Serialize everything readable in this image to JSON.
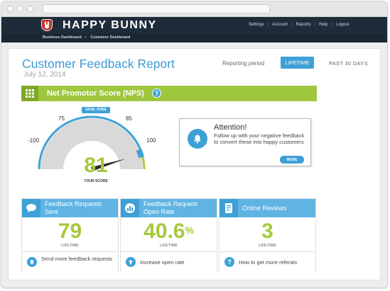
{
  "app": {
    "brand": "HAPPY BUNNY"
  },
  "topnav": [
    "Settings",
    "Account",
    "Reports",
    "Help",
    "Logout"
  ],
  "breadcrumbs": [
    "Business Dashboard",
    "Customer Dashboard"
  ],
  "report": {
    "title": "Customer Feedback Report",
    "date": "July 12, 2014",
    "period_label": "Reporting period",
    "period_selected": "LIFETIME",
    "period_other": "PAST 30 DAYS"
  },
  "nps": {
    "title": "Net Promotor Score (NPS)",
    "help": "?",
    "goal_zone": "GOAL ZONE",
    "min_label": "-100",
    "max_label": "100",
    "goal_low": "75",
    "goal_high": "85",
    "score": "81",
    "score_label": "YOUR SCORE",
    "gauge_value": 81
  },
  "attention": {
    "title": "Attention!",
    "text": "Follow up with your negative feedback to convert these into happy customers",
    "more": "MORE"
  },
  "cards": [
    {
      "title": "Feedback Requests Sent",
      "value": "79",
      "suffix": "",
      "sub": "LIFETIME",
      "action": "Send more feedback requests"
    },
    {
      "title": "Feedback Request Open Rate",
      "value": "40.6",
      "suffix": "%",
      "sub": "LIFETIME",
      "action": "Increase open rate"
    },
    {
      "title": "Online Reviews",
      "value": "3",
      "suffix": "",
      "sub": "LIFETIME",
      "action": "How to get more referals"
    }
  ],
  "colors": {
    "primary": "#3da1d6",
    "green": "#9ec73d",
    "dark": "#1e2c3a",
    "gauge_grey": "#d9d9d9"
  }
}
